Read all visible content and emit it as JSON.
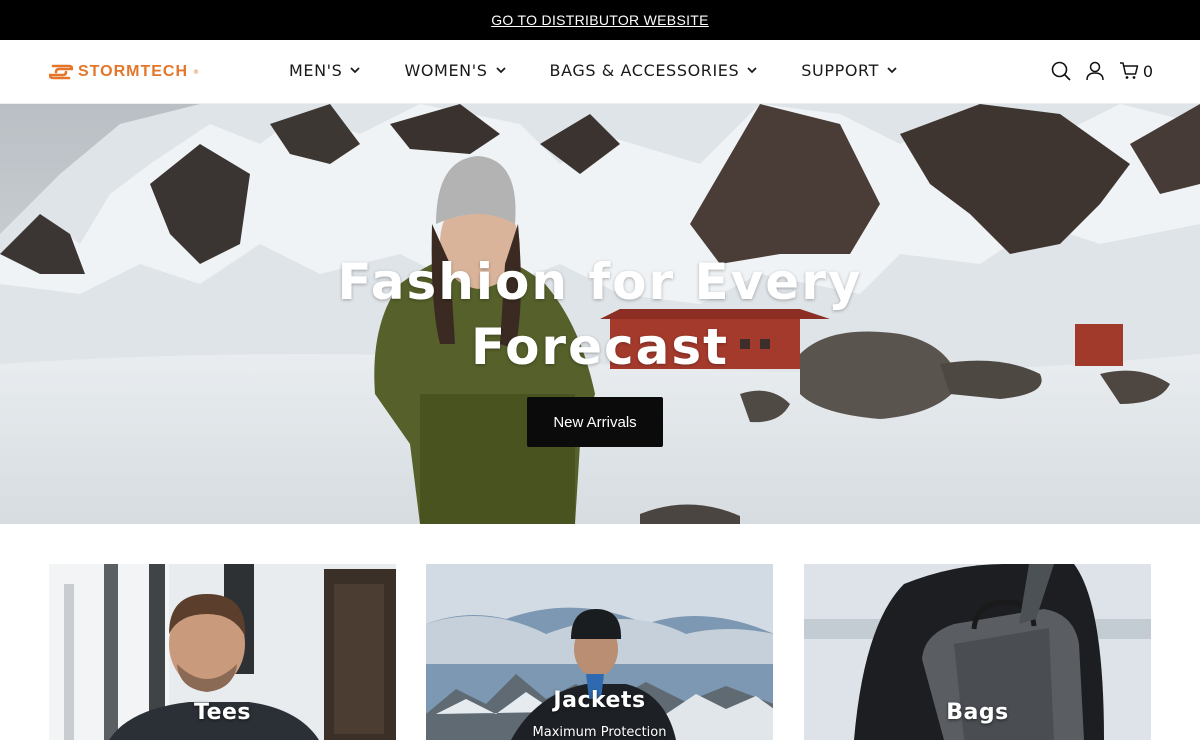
{
  "announcement": {
    "link_text": "GO TO DISTRIBUTOR WEBSITE"
  },
  "brand": {
    "name": "STORMTECH",
    "registered": "®",
    "color": "#e3762a"
  },
  "nav": {
    "items": [
      {
        "label": "MEN'S"
      },
      {
        "label": "WOMEN'S"
      },
      {
        "label": "BAGS & ACCESSORIES"
      },
      {
        "label": "SUPPORT"
      }
    ]
  },
  "header_icons": {
    "search": "search-icon",
    "account": "user-icon",
    "cart": "cart-icon",
    "cart_count": "0"
  },
  "hero": {
    "title_line1": "Fashion for Every",
    "title_line2": "Forecast",
    "button_label": "New Arrivals"
  },
  "categories": [
    {
      "label": "Tees",
      "subtitle": ""
    },
    {
      "label": "Jackets",
      "subtitle": "Maximum Protection"
    },
    {
      "label": "Bags",
      "subtitle": ""
    }
  ]
}
